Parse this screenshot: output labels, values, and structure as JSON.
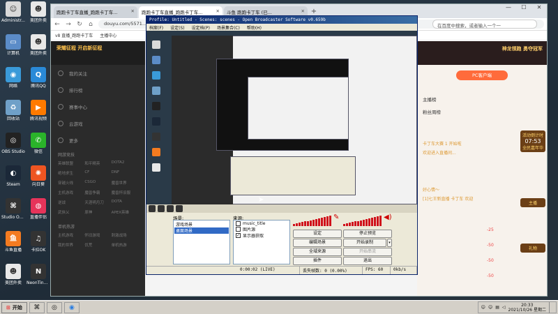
{
  "desktop": {
    "icons": [
      {
        "label": "Administr...",
        "glyph": "☺",
        "bg": "#d9d9d9"
      },
      {
        "label": "计算机",
        "glyph": "▭",
        "bg": "#5b8cc8"
      },
      {
        "label": "网络",
        "glyph": "◉",
        "bg": "#3a9ad9"
      },
      {
        "label": "回收站",
        "glyph": "♻",
        "bg": "#6fa0c8"
      },
      {
        "label": "OBS Studio",
        "glyph": "◎",
        "bg": "#222"
      },
      {
        "label": "Steam",
        "glyph": "◐",
        "bg": "#1b2838"
      },
      {
        "label": "Studio One 3",
        "glyph": "⌘",
        "bg": "#333"
      },
      {
        "label": "斗鱼直播",
        "glyph": "鱼",
        "bg": "#f47b20"
      },
      {
        "label": "美团外卖\n备份",
        "glyph": "☻",
        "bg": "#e8e8e8"
      },
      {
        "label": "美团外卖",
        "glyph": "☻",
        "bg": "#e8e8e8"
      },
      {
        "label": "美团外卖\n备份",
        "glyph": "☻",
        "bg": "#e8e8e8"
      },
      {
        "label": "腾讯QQ",
        "glyph": "Q",
        "bg": "#2a8ad8"
      },
      {
        "label": "腾讯视频",
        "glyph": "▶",
        "bg": "#ff7a00"
      },
      {
        "label": "微信",
        "glyph": "✆",
        "bg": "#2ab32a"
      },
      {
        "label": "向日葵",
        "glyph": "✺",
        "bg": "#ee5522"
      },
      {
        "label": "直播伴侣",
        "glyph": "◍",
        "bg": "#e6345a"
      },
      {
        "label": "卡拉OK",
        "glyph": "♫",
        "bg": "#333"
      },
      {
        "label": "NeonTing...",
        "glyph": "N",
        "bg": "#333"
      }
    ]
  },
  "chrome": {
    "tabs": [
      {
        "label": "跑跑卡丁车直播_跑跑卡丁车...",
        "active": false
      },
      {
        "label": "跑跑卡丁车直播_跑跑卡丁车...",
        "active": true
      },
      {
        "label": "斗鱼 跑跑卡丁车 (已...",
        "active": false
      }
    ],
    "new_tab": "+",
    "url": "douyu.com/5571...",
    "search_placeholder": "在百度中搜索，或者输入一个一",
    "bookmarks": [
      "v8 直播_跑跑卡丁车",
      "主播中心"
    ],
    "win_controls": [
      "—",
      "☐",
      "✕"
    ]
  },
  "douyu": {
    "banner": "荣耀征程 开启新征程",
    "sidebar_items": [
      "我的关注",
      "排行榜",
      "赛事中心",
      "云游戏",
      "更多"
    ],
    "hot_games_title": "网游竞技",
    "hot_games": [
      "英雄联盟",
      "和平精英",
      "DOTA2",
      "绝地求生",
      "CF",
      "DNF",
      "穿越火线",
      "CSGO",
      "魔兽世界",
      "主机游戏",
      "魔兽争霸",
      "魔兽怀旧服",
      "逆战",
      "天涯明月刀",
      "DOTA",
      "武侠乂",
      "原神",
      "APEX英雄"
    ],
    "single_games_title": "单机热游",
    "single_games": [
      "主机游戏",
      "怀旧游戏",
      "刺激战场",
      "我的世界",
      "饥荒",
      "单机热游"
    ],
    "right_top": "神龙领跑 勇夺冠军",
    "pc_button": "PC客户端",
    "rank_title": "主播榜",
    "rank_title2": "粉丝周榜",
    "chat": [
      "卡丁车大赛 1 开始啦",
      "欢迎进入直播间...",
      "好心情～",
      "[1]七王新直播 卡丁车 欢迎"
    ],
    "gift_levels": [
      "-25",
      "-50",
      "-50",
      "-50"
    ],
    "timer": "07:53",
    "gift_labels": [
      "活动倒计时",
      "全民嘉年华",
      "主播",
      "礼物"
    ]
  },
  "obs": {
    "title": "Profile: Untitled - Scenes: scenes - Open Broadcaster Software v0.659b",
    "menu": [
      "档案(F)",
      "设定(S)",
      "设定档(P)",
      "场景集合(C)",
      "帮助(H)"
    ],
    "scenes_label": "场景:",
    "scenes": [
      {
        "name": "游戏场景",
        "selected": false
      },
      {
        "name": "桌面场景",
        "selected": true
      }
    ],
    "sources_label": "来源:",
    "sources": [
      {
        "name": "music_title",
        "checked": false
      },
      {
        "name": "图片源",
        "checked": false
      },
      {
        "name": "显示器获取",
        "checked": true
      }
    ],
    "buttons": {
      "settings": "设定",
      "stop_preview": "停止预览",
      "edit_scene": "编辑场景",
      "start_recording": "开始录制",
      "global_sources": "全域来源",
      "start_streaming": "开始串流",
      "plugins": "插件",
      "exit": "退出"
    },
    "status": {
      "time": "0:00:02 (LIVE)",
      "dropped": "丢失帧数: 0 (0.00%)",
      "fps": "FPS: 60",
      "bitrate": "0kb/s"
    }
  },
  "taskbar": {
    "start": "开始",
    "time": "20:33",
    "date": "2021/10/26 星期二"
  }
}
